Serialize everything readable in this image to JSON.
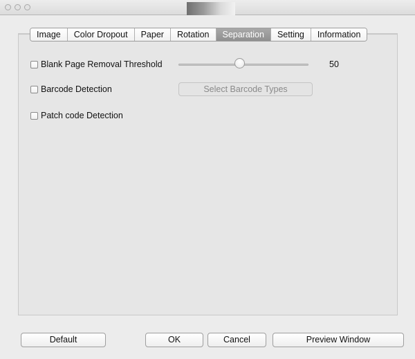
{
  "tabs": [
    {
      "label": "Image",
      "active": false
    },
    {
      "label": "Color Dropout",
      "active": false
    },
    {
      "label": "Paper",
      "active": false
    },
    {
      "label": "Rotation",
      "active": false
    },
    {
      "label": "Separation",
      "active": true
    },
    {
      "label": "Setting",
      "active": false
    },
    {
      "label": "Information",
      "active": false
    }
  ],
  "separation": {
    "blank_page": {
      "label": "Blank Page Removal Threshold",
      "checked": false,
      "value": "50",
      "fraction": 0.47
    },
    "barcode": {
      "label": "Barcode Detection",
      "checked": false,
      "button_label": "Select Barcode Types",
      "button_enabled": false
    },
    "patch_code": {
      "label": "Patch code Detection",
      "checked": false
    }
  },
  "footer": {
    "default_label": "Default",
    "ok_label": "OK",
    "cancel_label": "Cancel",
    "preview_label": "Preview Window"
  },
  "colors": {
    "window_bg": "#ececec",
    "panel_bg": "#e6e6e6",
    "active_tab": "#9b9b9b"
  }
}
